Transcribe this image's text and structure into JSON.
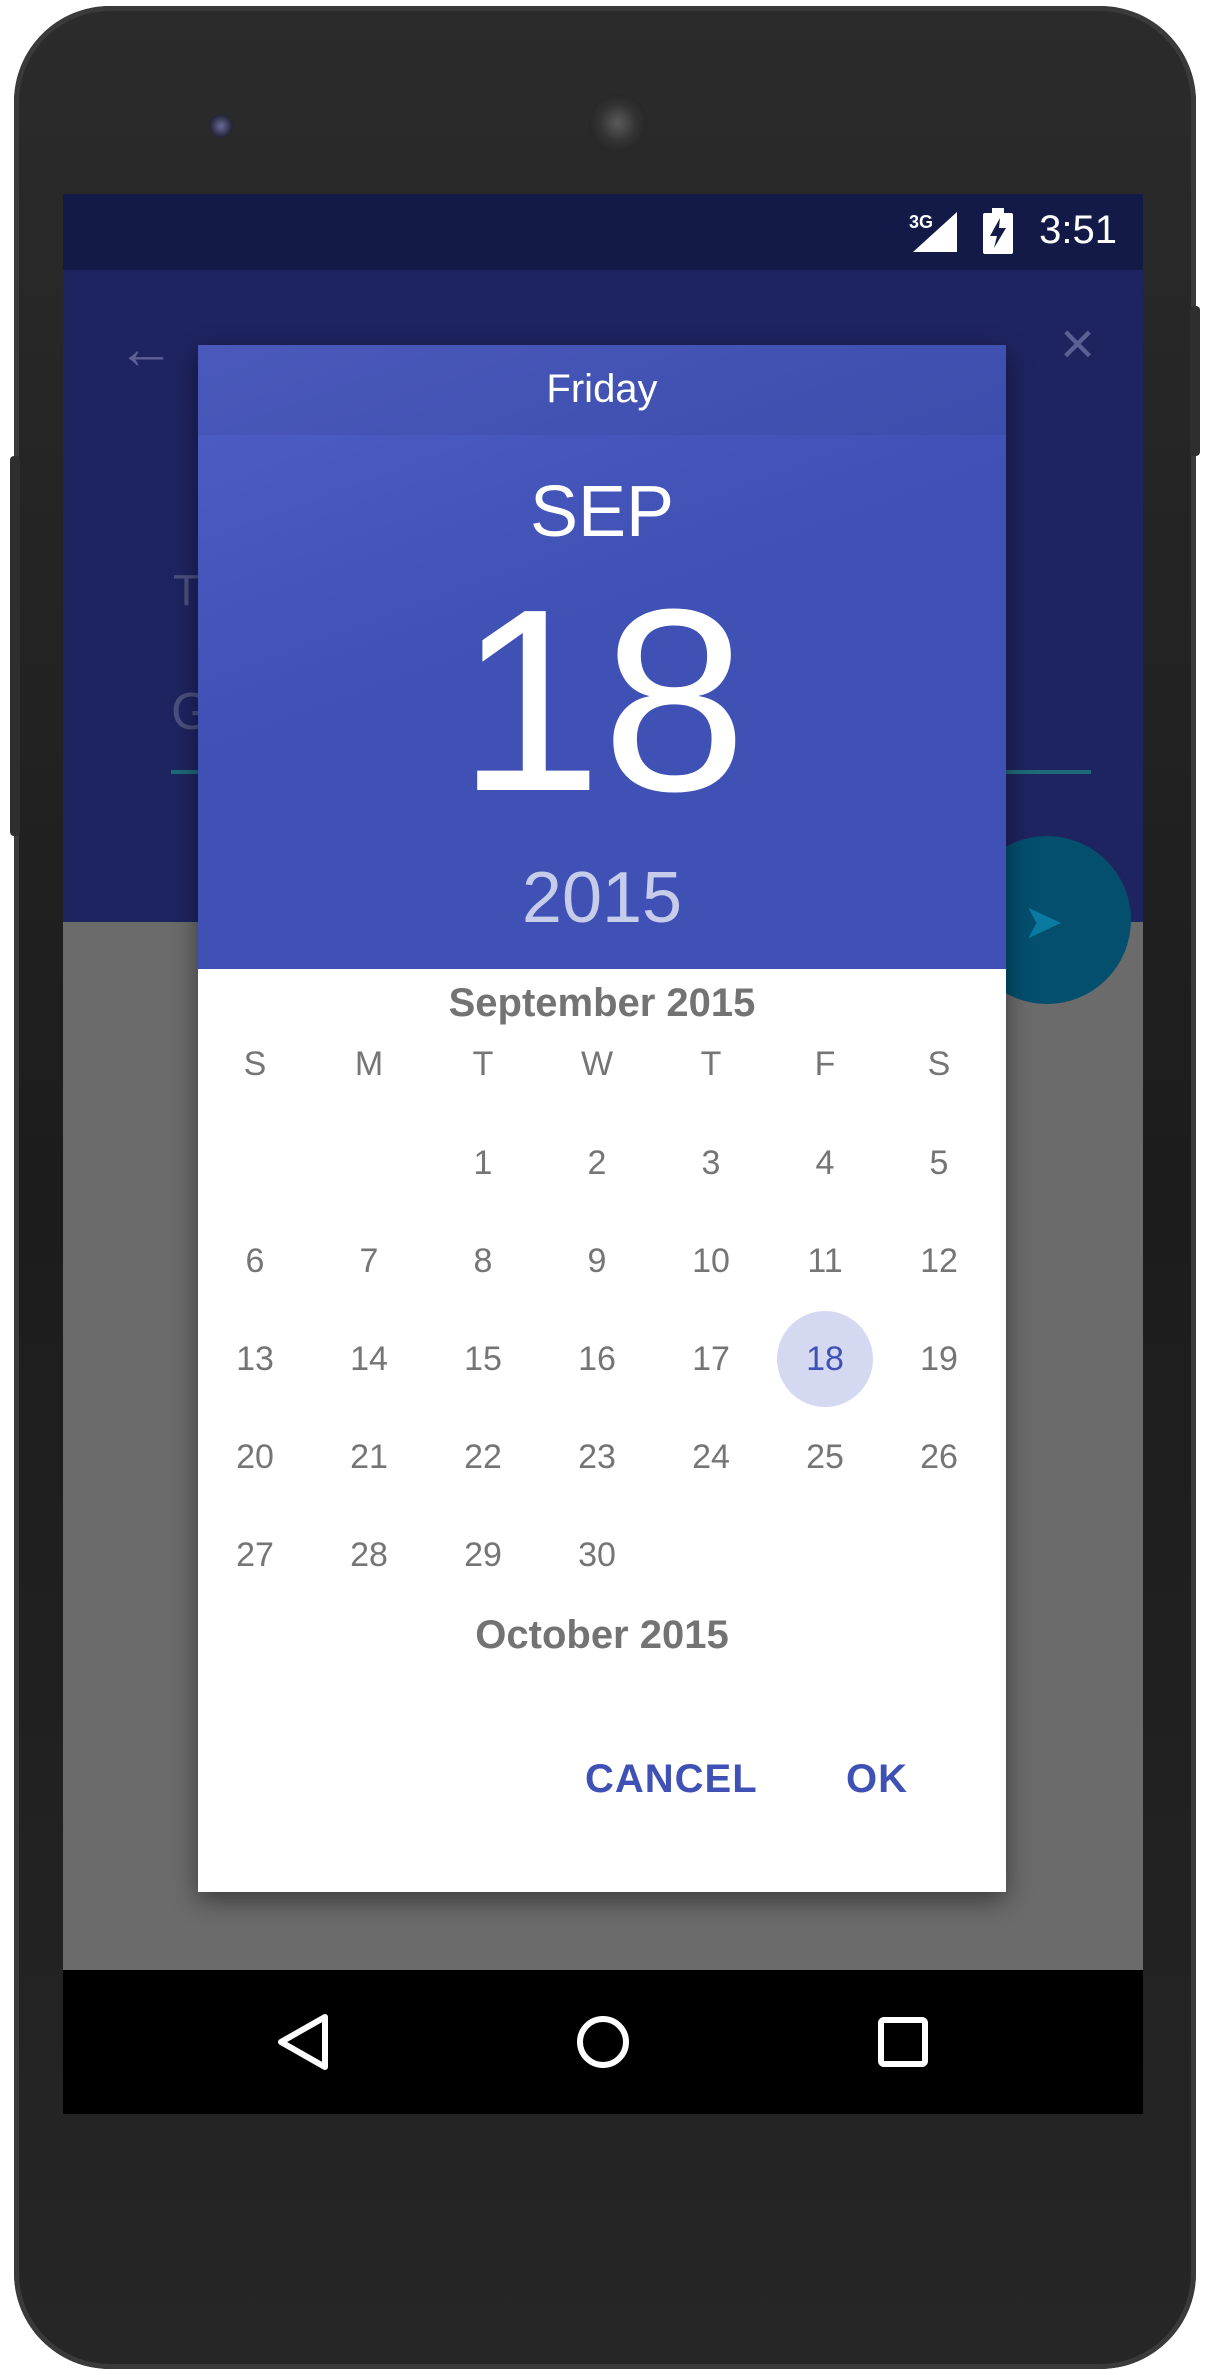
{
  "status_bar": {
    "network": "3G",
    "time": "3:51"
  },
  "background_screen": {
    "partial_field_label": "T",
    "partial_field_value": "G"
  },
  "date_picker": {
    "day_of_week": "Friday",
    "month_abbr": "SEP",
    "day": "18",
    "year": "2015",
    "current_month_title": "September 2015",
    "next_month_title": "October 2015",
    "weekday_headers": [
      "S",
      "M",
      "T",
      "W",
      "T",
      "F",
      "S"
    ],
    "first_weekday_index": 2,
    "days_in_month": 30,
    "selected_day": 18,
    "cancel_label": "CANCEL",
    "ok_label": "OK"
  },
  "colors": {
    "accent": "#3f51b5",
    "selected_day_bg": "#d4d8f1",
    "status_bar": "#141a48",
    "app_bar_dimmed": "#1e2460",
    "fab_dimmed": "#044f6e"
  },
  "nav_icons": [
    "back-icon",
    "home-icon",
    "recents-icon"
  ]
}
